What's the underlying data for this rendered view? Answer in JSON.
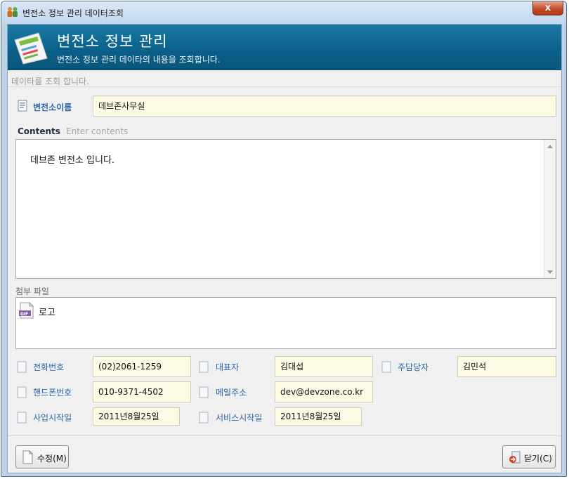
{
  "window": {
    "title": "변전소 정보 관리 데이터조회",
    "close_label": "x"
  },
  "header": {
    "title": "변전소 정보 관리",
    "subtitle": "변전소 정보 관리 데이타의 내용을 조회합니다."
  },
  "status_hint": "데이타를 조회 합니다.",
  "name_field": {
    "label": "변전소이름",
    "value": "데브존사무실"
  },
  "contents": {
    "label": "Contents",
    "placeholder": "Enter contents",
    "text": "데브존 변전소 입니다."
  },
  "attachments": {
    "label": "첨부 파일",
    "items": [
      {
        "name": "로고",
        "icon": "gif-file-icon"
      }
    ]
  },
  "info_fields": {
    "phone": {
      "label": "전화번호",
      "value": "(02)2061-1259"
    },
    "representative": {
      "label": "대표자",
      "value": "김대섭"
    },
    "manager": {
      "label": "주담당자",
      "value": "김민석"
    },
    "mobile": {
      "label": "핸드폰번호",
      "value": "010-9371-4502"
    },
    "email": {
      "label": "메일주소",
      "value": "dev@devzone.co.kr"
    },
    "business_start": {
      "label": "사업시작일",
      "value": "2011년8월25일"
    },
    "service_start": {
      "label": "서비스시작일",
      "value": "2011년8월25일"
    }
  },
  "buttons": {
    "edit": "수정(M)",
    "close": "닫기(C)"
  }
}
